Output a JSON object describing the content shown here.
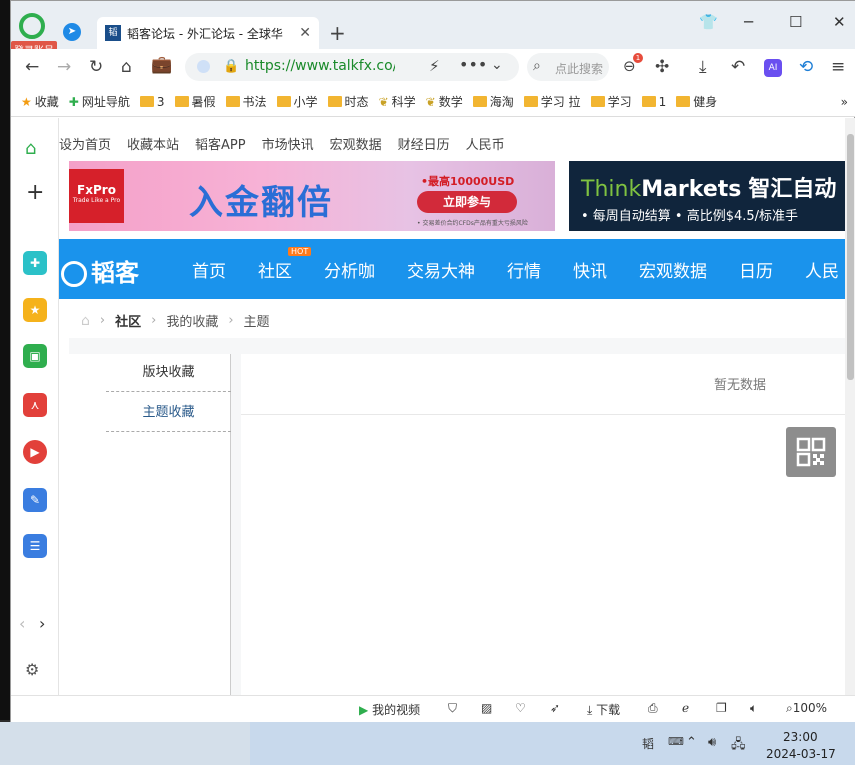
{
  "browser": {
    "login_badge": "登录账号",
    "tab_title": "韬客论坛 - 外汇论坛 - 全球华",
    "tab_close": "✕",
    "new_tab": "+",
    "url": "https://www.talkfx.co/user",
    "search_placeholder": "点此搜索",
    "notify_count": "1",
    "ai_label": "AI"
  },
  "bookmarks": [
    {
      "label": "收藏",
      "type": "star"
    },
    {
      "label": "网址导航",
      "type": "nav"
    },
    {
      "label": "3",
      "type": "folder"
    },
    {
      "label": "暑假",
      "type": "folder"
    },
    {
      "label": "书法",
      "type": "folder"
    },
    {
      "label": "小学",
      "type": "folder"
    },
    {
      "label": "时态",
      "type": "folder"
    },
    {
      "label": "科学",
      "type": "plant"
    },
    {
      "label": "数学",
      "type": "plant"
    },
    {
      "label": "海淘",
      "type": "folder"
    },
    {
      "label": "学习 拉",
      "type": "folder"
    },
    {
      "label": "学习",
      "type": "folder"
    },
    {
      "label": "1",
      "type": "folder"
    },
    {
      "label": "健身",
      "type": "folder"
    }
  ],
  "site": {
    "toplinks": [
      "设为首页",
      "收藏本站",
      "韬客APP",
      "市场快讯",
      "宏观数据",
      "财经日历",
      "人民币"
    ],
    "banner1": {
      "brand": "FxPro",
      "brand_tag": "Trade Like a Pro",
      "title": "入金翻倍",
      "sub": "•最高10000USD",
      "button": "立即参与",
      "note": "• 交易差价合约CFDs产品有重大亏损风险"
    },
    "banner2": {
      "brand_a": "Think",
      "brand_b": "Markets",
      "brand_cn": "智汇自动",
      "bullets": "• 每周自动结算    • 高比例$4.5/标准手"
    },
    "nav_logo": "韬客",
    "nav_hot": "HOT",
    "nav": [
      "首页",
      "社区",
      "分析咖",
      "交易大神",
      "行情",
      "快讯",
      "宏观数据",
      "日历",
      "人民"
    ],
    "breadcrumb": [
      "社区",
      "我的收藏",
      "主题"
    ],
    "menu": [
      "版块收藏",
      "主题收藏"
    ],
    "empty": "暂无数据"
  },
  "statusbar": {
    "video": "我的视频",
    "download": "下载",
    "zoom": "100%"
  },
  "taskbar": {
    "time": "23:00",
    "date": "2024-03-17"
  },
  "colors": {
    "nav_blue": "#1a93ec",
    "url_green": "#1a8a2a",
    "brand_red": "#d6202a"
  }
}
